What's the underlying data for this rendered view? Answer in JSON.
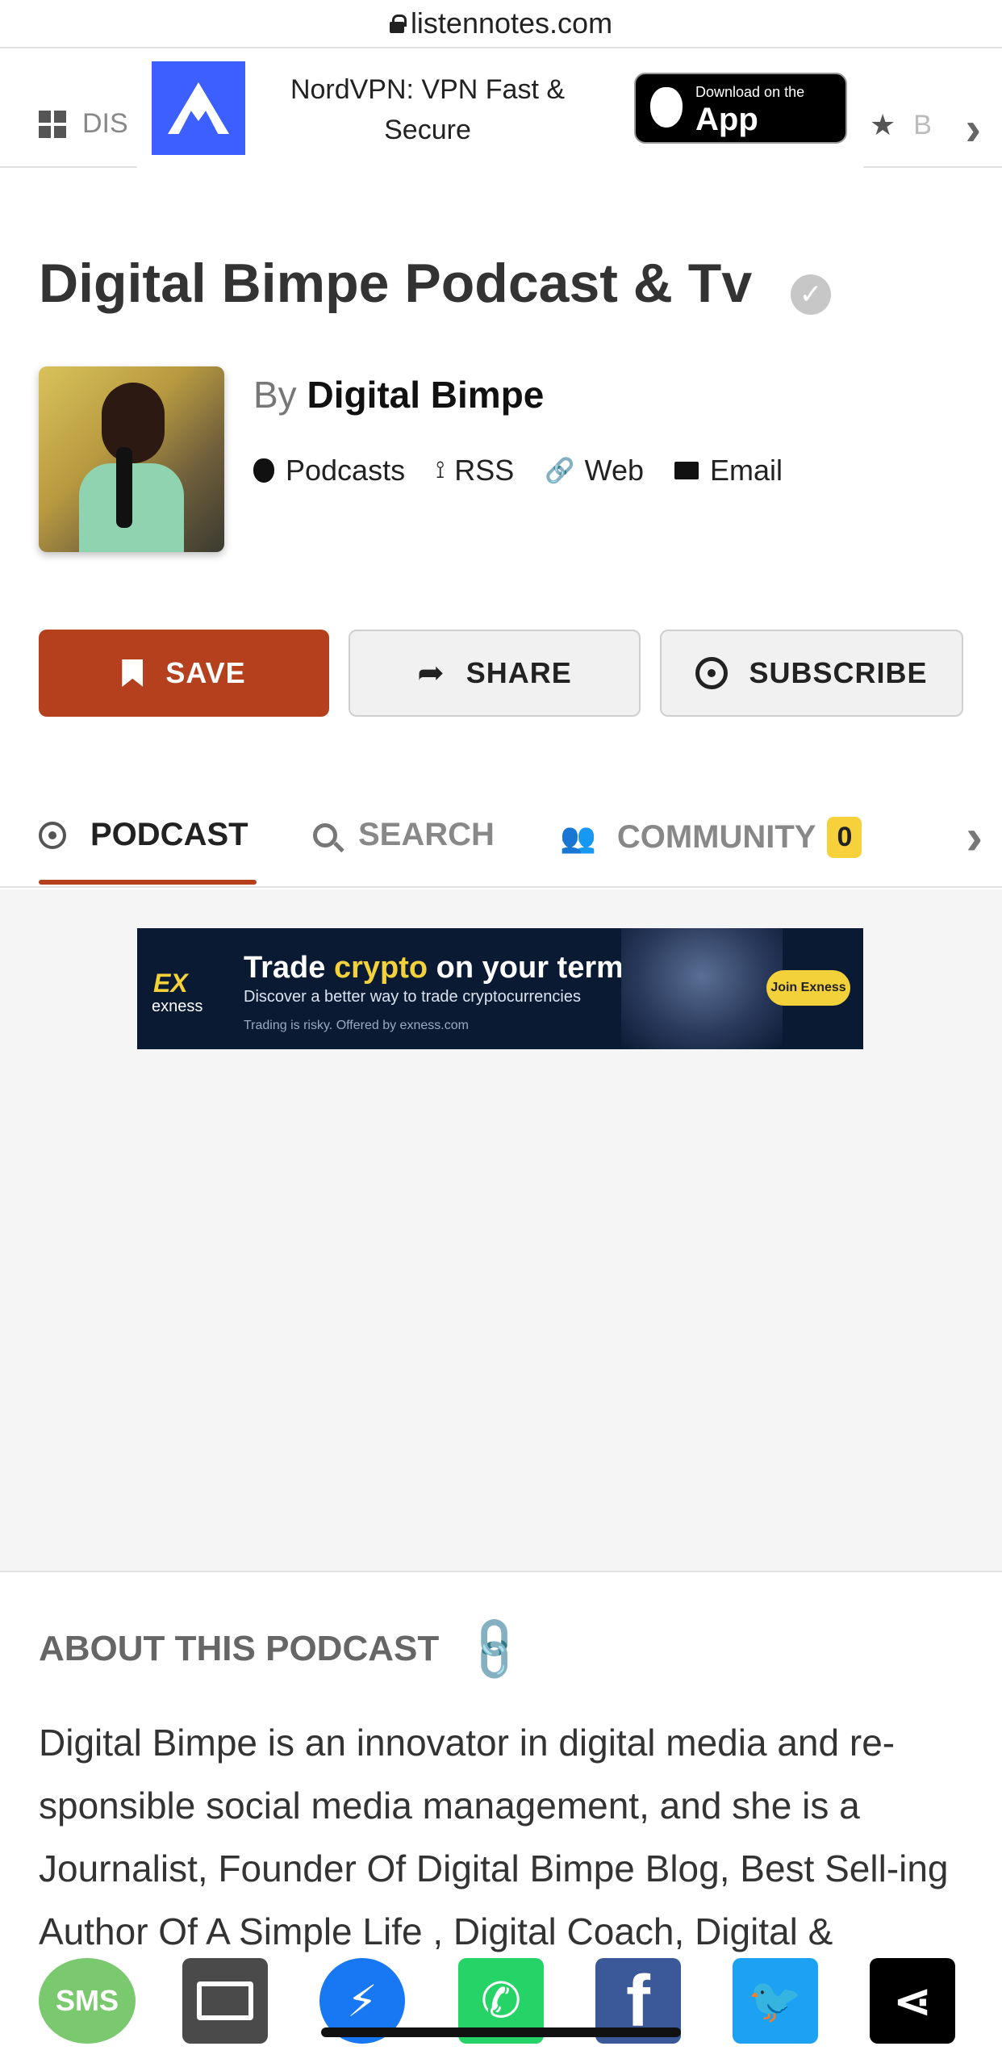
{
  "browser": {
    "url": "listennotes.com"
  },
  "topnav": {
    "left_label": "DIS",
    "right_label": "B"
  },
  "nord_ad": {
    "title": "NordVPN: VPN Fast & Secure",
    "store_small": "Download on the",
    "store_big": "App Store"
  },
  "header": {
    "title": "Digital Bimpe Podcast & Tv",
    "verified_glyph": "✓"
  },
  "byline": {
    "prefix": "By",
    "author": "Digital Bimpe"
  },
  "links": {
    "podcasts": "Podcasts",
    "rss": "RSS",
    "web": "Web",
    "email": "Email"
  },
  "actions": {
    "save": "SAVE",
    "share": "SHARE",
    "subscribe": "SUBSCRIBE"
  },
  "tabs": [
    {
      "label": "PODCAST"
    },
    {
      "label": "SEARCH"
    },
    {
      "label": "COMMUNITY",
      "badge": "0"
    }
  ],
  "exness_ad": {
    "logo": "EX",
    "logo_sub": "exness",
    "headline_pre": "Trade ",
    "headline_accent": "crypto",
    "headline_post": " on your terms",
    "sub": "Discover a better way to trade cryptocurrencies",
    "risk": "Trading is risky. Offered by exness.com",
    "cta": "Join Exness"
  },
  "about": {
    "heading": "ABOUT THIS PODCAST",
    "text": "Digital Bimpe is an innovator in digital media and re-sponsible social media management, and she is a Journalist, Founder Of Digital Bimpe Blog, Best Sell-ing Author Of A Simple Life , Digital Coach, Digital & Content Marketer"
  },
  "share": {
    "sms": "SMS",
    "messenger_glyph": "⚡",
    "whatsapp_glyph": "✆",
    "facebook_glyph": "f",
    "twitter_glyph": "🐦",
    "more_glyph": "⋖"
  },
  "colors": {
    "accent": "#b5401e",
    "badge": "#f7d13b"
  }
}
